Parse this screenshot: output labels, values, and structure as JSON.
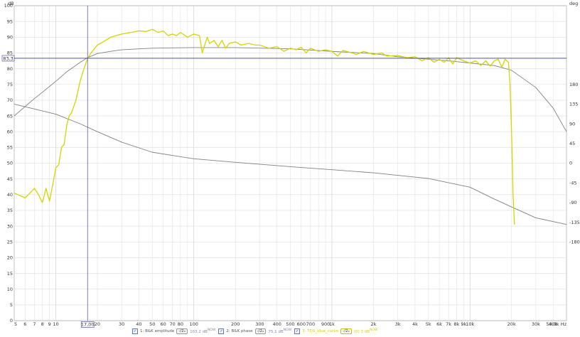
{
  "chart_data": {
    "type": "line",
    "xscale": "log",
    "xlim": [
      5,
      50000
    ],
    "ylim": [
      0,
      100
    ],
    "ylim_right": [
      -360,
      360
    ],
    "ylabel": "dB",
    "ylabel_right": "deg",
    "xunit": "Hz",
    "grid": true,
    "x_ticks": [
      {
        "v": 5,
        "label": "5"
      },
      {
        "v": 6,
        "label": "6"
      },
      {
        "v": 7,
        "label": "7"
      },
      {
        "v": 8,
        "label": "8"
      },
      {
        "v": 9,
        "label": "9"
      },
      {
        "v": 10,
        "label": "10"
      },
      {
        "v": 20,
        "label": "20"
      },
      {
        "v": 30,
        "label": "30"
      },
      {
        "v": 40,
        "label": "40"
      },
      {
        "v": 50,
        "label": "50"
      },
      {
        "v": 60,
        "label": "60"
      },
      {
        "v": 70,
        "label": "70"
      },
      {
        "v": 80,
        "label": "80"
      },
      {
        "v": 100,
        "label": "100"
      },
      {
        "v": 200,
        "label": "200"
      },
      {
        "v": 300,
        "label": "300"
      },
      {
        "v": 400,
        "label": "400"
      },
      {
        "v": 500,
        "label": "500"
      },
      {
        "v": 600,
        "label": "600"
      },
      {
        "v": 700,
        "label": "700"
      },
      {
        "v": 900,
        "label": "900"
      },
      {
        "v": 1000,
        "label": "1k"
      },
      {
        "v": 2000,
        "label": "2k"
      },
      {
        "v": 3000,
        "label": "3k"
      },
      {
        "v": 4000,
        "label": "4k"
      },
      {
        "v": 5000,
        "label": "5k"
      },
      {
        "v": 6000,
        "label": "6k"
      },
      {
        "v": 7000,
        "label": "7k"
      },
      {
        "v": 8000,
        "label": "8k"
      },
      {
        "v": 9000,
        "label": "9k"
      },
      {
        "v": 10000,
        "label": "10k"
      },
      {
        "v": 20000,
        "label": "20k"
      },
      {
        "v": 30000,
        "label": "30k"
      },
      {
        "v": 40000,
        "label": "40k"
      },
      {
        "v": 50000,
        "label": "50,0k Hz"
      }
    ],
    "y_ticks": [
      0,
      5,
      10,
      15,
      20,
      25,
      30,
      35,
      40,
      45,
      50,
      55,
      60,
      65,
      70,
      75,
      80,
      85,
      90,
      95,
      100
    ],
    "y_ticks_right": [
      180,
      135,
      90,
      45,
      0,
      -45,
      -90,
      -135,
      -180
    ],
    "cursor": {
      "x": 17,
      "y": 83.3,
      "x_label": "17,00",
      "y_label": "83,3"
    },
    "series": [
      {
        "name": "1: B&K amplitude",
        "color": "#808080",
        "axis": "left",
        "x": [
          5,
          6,
          7,
          8,
          10,
          12,
          15,
          17,
          20,
          25,
          30,
          40,
          50,
          70,
          100,
          200,
          500,
          1000,
          2000,
          3000,
          5000,
          7000,
          10000,
          15000,
          20000,
          30000,
          40000,
          50000
        ],
        "y": [
          65,
          68,
          70.5,
          72.5,
          76,
          79,
          82,
          83.5,
          84.8,
          85.5,
          86,
          86.3,
          86.5,
          86.6,
          86.7,
          86.7,
          86.3,
          85.5,
          84.8,
          83.8,
          83,
          82.5,
          81.8,
          81,
          79.5,
          74,
          67.5,
          60
        ]
      },
      {
        "name": "2: B&K phase",
        "color": "#808080",
        "axis": "right",
        "x": [
          5,
          10,
          15,
          20,
          30,
          50,
          100,
          200,
          500,
          1000,
          2000,
          5000,
          10000,
          15000,
          20000,
          30000,
          50000
        ],
        "y": [
          135,
          112,
          90,
          72,
          48,
          25,
          10,
          2,
          -8,
          -15,
          -22,
          -35,
          -55,
          -82,
          -100,
          -125,
          -140
        ]
      },
      {
        "name": "3: TDS_blue_curve",
        "color": "#d4d400",
        "axis": "left",
        "x": [
          5,
          6,
          6.5,
          7,
          7.5,
          8,
          8.5,
          9,
          9.5,
          10,
          10.5,
          11,
          11.5,
          12,
          12.5,
          13,
          14,
          15,
          16,
          17,
          18,
          20,
          22,
          25,
          30,
          35,
          40,
          45,
          50,
          55,
          60,
          65,
          70,
          75,
          80,
          90,
          95,
          100,
          110,
          115,
          125,
          130,
          140,
          150,
          160,
          170,
          180,
          200,
          220,
          250,
          280,
          300,
          350,
          400,
          450,
          500,
          550,
          600,
          650,
          700,
          800,
          900,
          1000,
          1100,
          1200,
          1400,
          1500,
          1700,
          2000,
          2300,
          2500,
          3000,
          3500,
          4000,
          4500,
          5000,
          5500,
          6000,
          6500,
          7000,
          7500,
          8000,
          9000,
          10000,
          11000,
          12000,
          13000,
          14000,
          15000,
          16000,
          17000,
          18000,
          19000,
          19500,
          20000,
          20500,
          21000
        ],
        "y": [
          40.5,
          39,
          40.5,
          42,
          40,
          37.5,
          42,
          38,
          43,
          48.5,
          49.5,
          55,
          56,
          62,
          65,
          66,
          70,
          76,
          80,
          83.3,
          85,
          87.5,
          88.5,
          90,
          91,
          91.5,
          92,
          91.8,
          92.5,
          91.5,
          92,
          90.5,
          91,
          90.5,
          91.5,
          90,
          90.5,
          91,
          90.5,
          85,
          90,
          88,
          89,
          87,
          89,
          86.5,
          88,
          88.5,
          87.5,
          88,
          87.5,
          87.5,
          86.5,
          87,
          85.5,
          86.5,
          86,
          86.8,
          85,
          86.5,
          85.5,
          86,
          85.5,
          84,
          85.8,
          85,
          84.5,
          85.5,
          84.5,
          85,
          84,
          84.2,
          83.5,
          83.8,
          82.5,
          83.5,
          82,
          83,
          82,
          83.5,
          81.5,
          83.5,
          82.5,
          81.8,
          82.5,
          81,
          82.5,
          80.8,
          82.5,
          83,
          80.5,
          83,
          82,
          75,
          60,
          40,
          30.5
        ]
      }
    ]
  },
  "legend": {
    "items": [
      {
        "check": "✓",
        "label": "1: B&K amplitude",
        "button": "-/2ₓ",
        "value": "103,2 dB",
        "value_sup": "NOW"
      },
      {
        "check": "✓",
        "label": "2: B&K phase",
        "button": "-/2ₓ",
        "value": "75,1 dB",
        "value_sup": "NOW"
      },
      {
        "check": "✓",
        "label": "3: TDS_blue_curve",
        "button": "-/2ₓ",
        "value": "(0) 3 dB",
        "value_sup": "NOW"
      }
    ]
  }
}
